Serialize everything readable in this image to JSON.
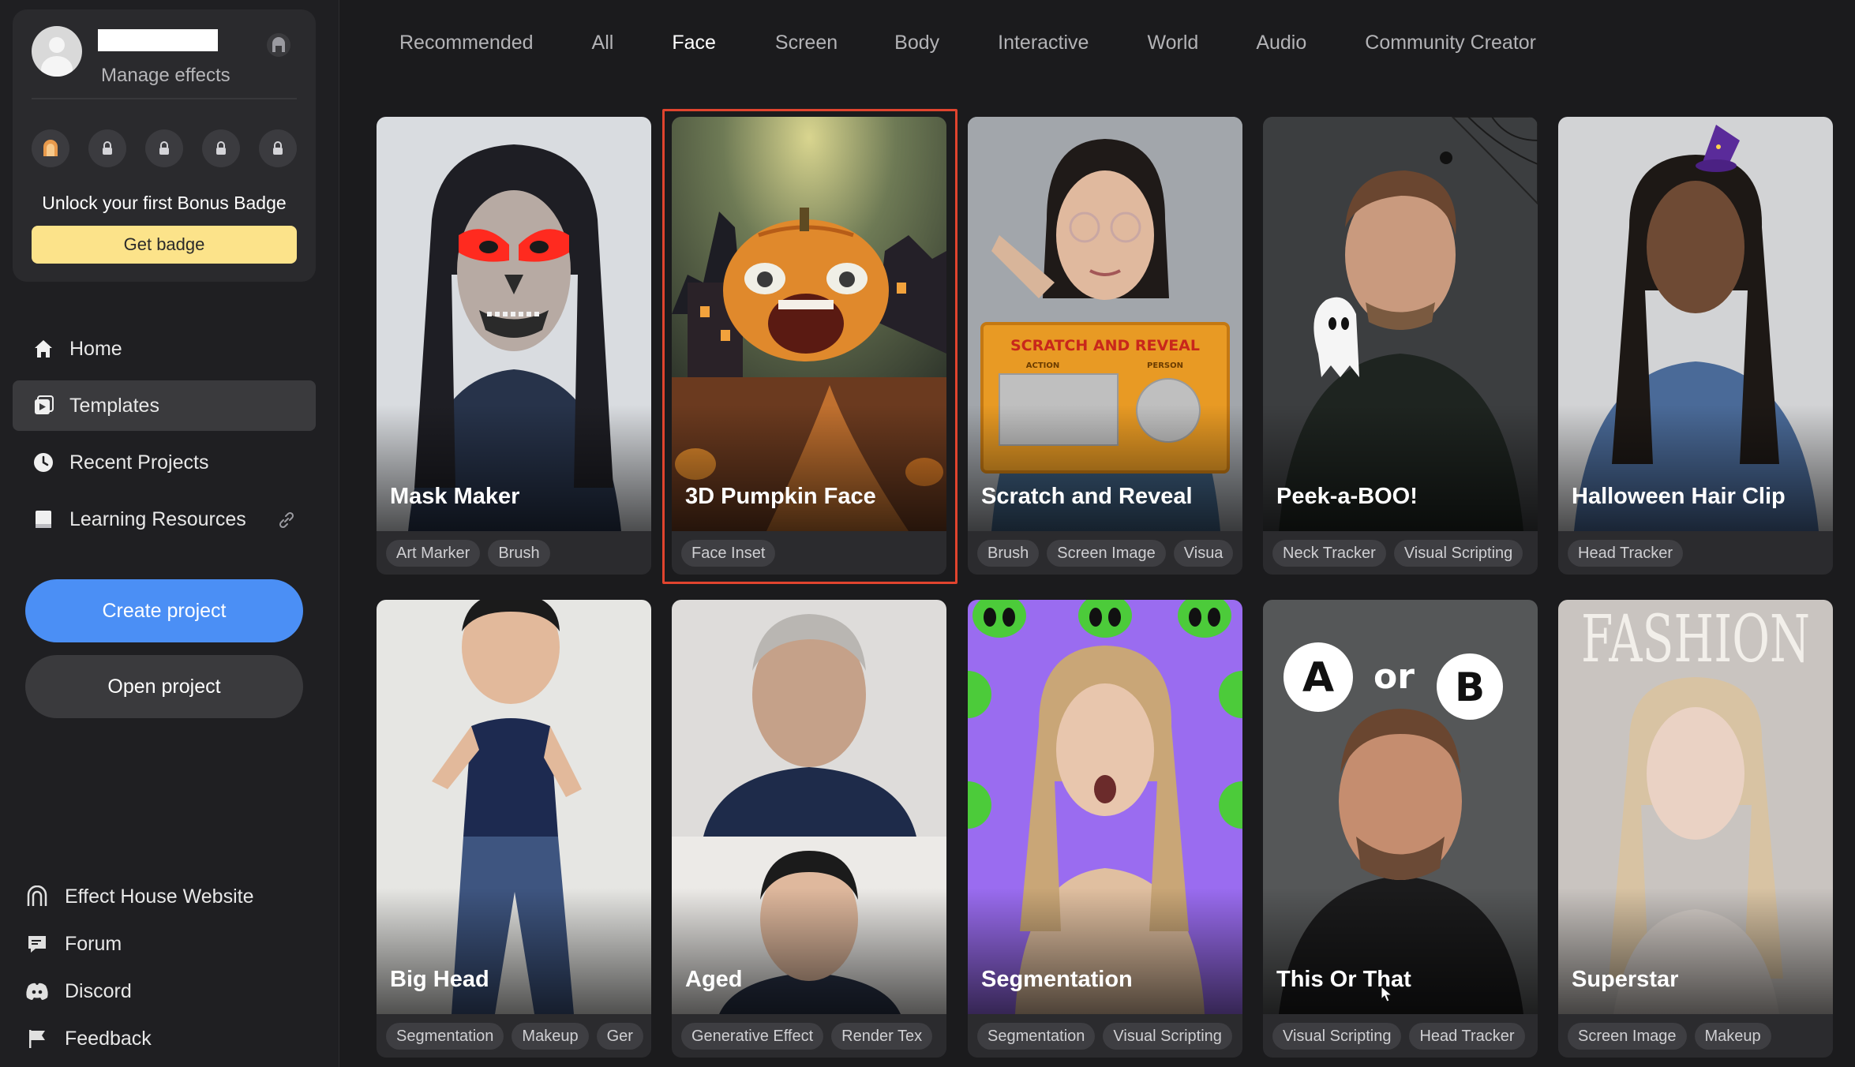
{
  "profile": {
    "manage_label": "Manage effects",
    "unlock_text": "Unlock your first Bonus Badge",
    "get_badge_label": "Get badge",
    "badges": [
      "bonus-badge-icon",
      "lock-icon",
      "lock-icon",
      "lock-icon",
      "lock-icon"
    ]
  },
  "nav": {
    "items": [
      {
        "label": "Home",
        "icon": "home-icon"
      },
      {
        "label": "Templates",
        "icon": "templates-icon",
        "active": true
      },
      {
        "label": "Recent Projects",
        "icon": "clock-icon"
      },
      {
        "label": "Learning Resources",
        "icon": "book-icon",
        "external": true
      }
    ]
  },
  "actions": {
    "create_label": "Create project",
    "open_label": "Open project"
  },
  "footer": {
    "items": [
      {
        "label": "Effect House Website",
        "icon": "effect-house-icon"
      },
      {
        "label": "Forum",
        "icon": "forum-icon"
      },
      {
        "label": "Discord",
        "icon": "discord-icon"
      },
      {
        "label": "Feedback",
        "icon": "flag-icon"
      }
    ]
  },
  "tabs": [
    {
      "label": "Recommended"
    },
    {
      "label": "All"
    },
    {
      "label": "Face",
      "active": true
    },
    {
      "label": "Screen"
    },
    {
      "label": "Body"
    },
    {
      "label": "Interactive"
    },
    {
      "label": "World"
    },
    {
      "label": "Audio"
    },
    {
      "label": "Community Creator"
    }
  ],
  "templates": [
    {
      "title": "Mask Maker",
      "tags": [
        "Art Marker",
        "Brush"
      ]
    },
    {
      "title": "3D Pumpkin Face",
      "tags": [
        "Face Inset"
      ],
      "selected": true
    },
    {
      "title": "Scratch and Reveal",
      "tags": [
        "Brush",
        "Screen Image",
        "Visua"
      ]
    },
    {
      "title": "Peek-a-BOO!",
      "tags": [
        "Neck Tracker",
        "Visual Scripting"
      ]
    },
    {
      "title": "Halloween Hair Clip",
      "tags": [
        "Head Tracker"
      ]
    },
    {
      "title": "Big Head",
      "tags": [
        "Segmentation",
        "Makeup",
        "Ger"
      ]
    },
    {
      "title": "Aged",
      "tags": [
        "Generative Effect",
        "Render Tex"
      ]
    },
    {
      "title": "Segmentation",
      "tags": [
        "Segmentation",
        "Visual Scripting"
      ]
    },
    {
      "title": "This Or That",
      "tags": [
        "Visual Scripting",
        "Head Tracker"
      ]
    },
    {
      "title": "Superstar",
      "tags": [
        "Screen Image",
        "Makeup"
      ]
    }
  ],
  "thumb_text": {
    "scratch_banner": "SCRATCH AND REVEAL",
    "scratch_action": "ACTION",
    "scratch_person": "PERSON",
    "or_a": "A",
    "or_word": "or",
    "or_b": "B",
    "fashion_word": "FASHION"
  }
}
